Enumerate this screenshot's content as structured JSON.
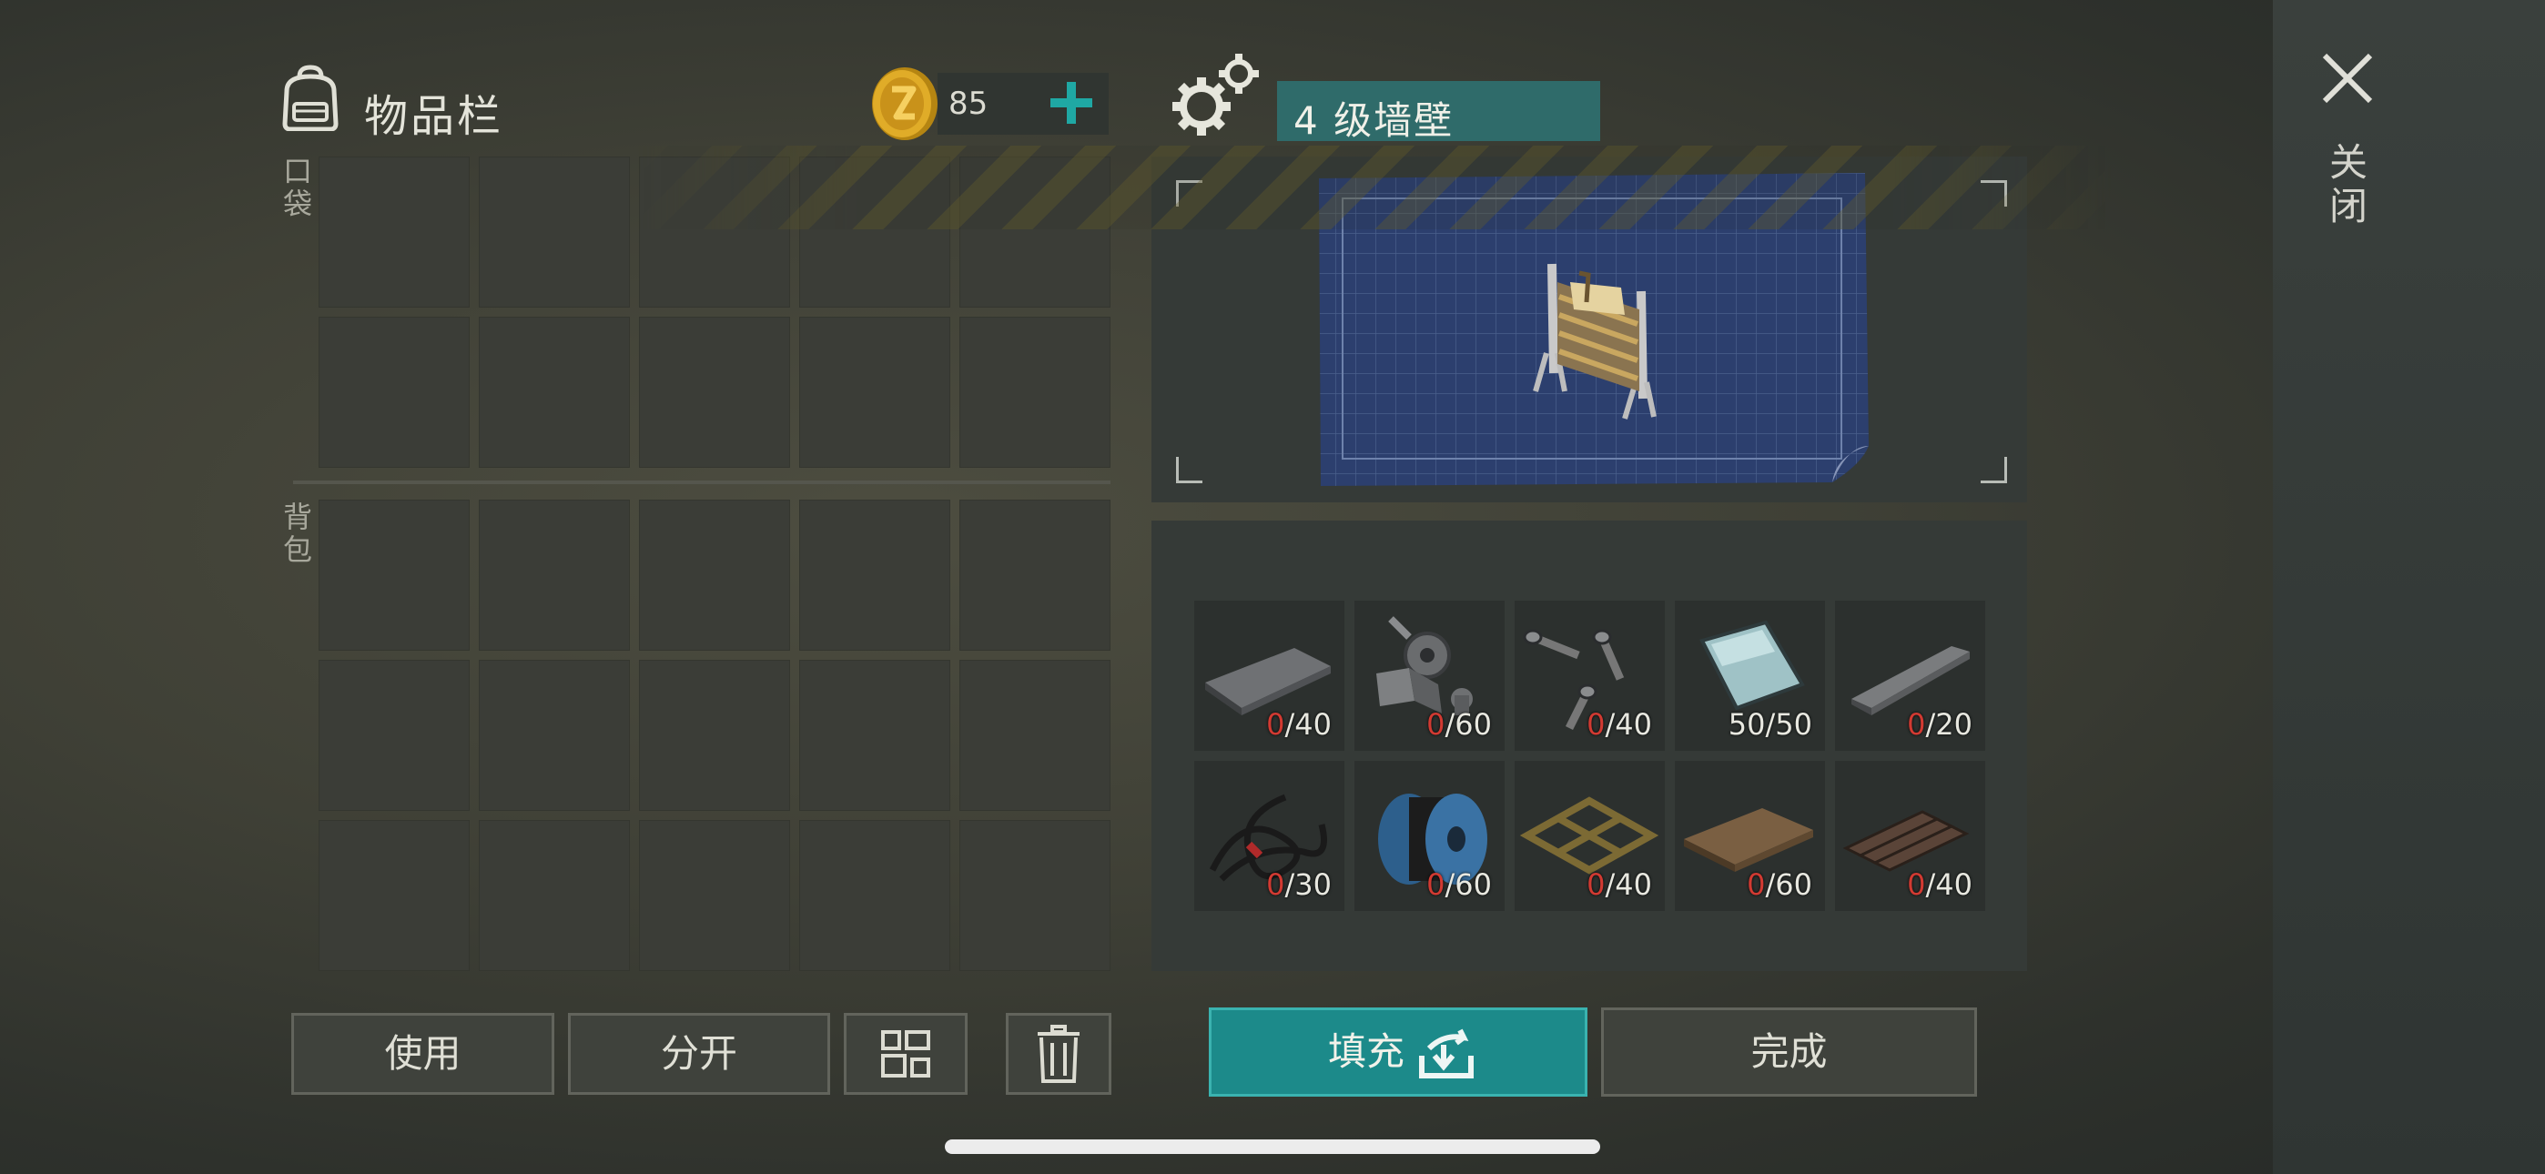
{
  "header": {
    "inventory_title": "物品栏",
    "currency_count": "85",
    "recipe_name": "4 级墙壁",
    "close_label": "关闭"
  },
  "sections": {
    "pocket_label": "口袋",
    "backpack_label": "背包"
  },
  "materials": [
    {
      "icon": "metal-plate-icon",
      "have": "0",
      "need": "/40"
    },
    {
      "icon": "gears-hinge-icon",
      "have": "0",
      "need": "/60"
    },
    {
      "icon": "screws-icon",
      "have": "0",
      "need": "/40"
    },
    {
      "icon": "glass-plate-icon",
      "have": "50",
      "need": "/50"
    },
    {
      "icon": "metal-bar-icon",
      "have": "0",
      "need": "/20"
    },
    {
      "icon": "wires-icon",
      "have": "0",
      "need": "/30"
    },
    {
      "icon": "cable-spool-icon",
      "have": "0",
      "need": "/60"
    },
    {
      "icon": "wood-frame-icon",
      "have": "0",
      "need": "/40"
    },
    {
      "icon": "plywood-icon",
      "have": "0",
      "need": "/60"
    },
    {
      "icon": "corrugated-sheet-icon",
      "have": "0",
      "need": "/40"
    }
  ],
  "buttons": {
    "use": "使用",
    "split": "分开",
    "fill": "填充",
    "done": "完成"
  },
  "colors": {
    "accent_teal": "#1c8a8a",
    "missing_red": "#d23a32"
  }
}
